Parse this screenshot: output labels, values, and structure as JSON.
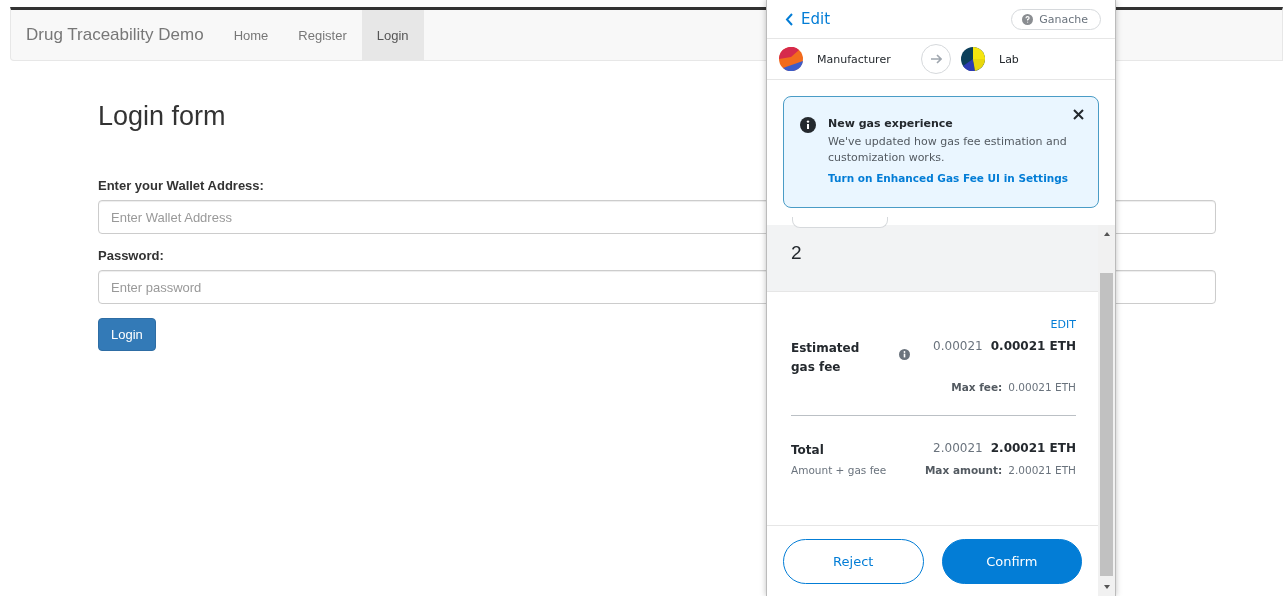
{
  "navbar": {
    "brand": "Drug Traceability Demo",
    "links": [
      {
        "label": "Home",
        "selected": false
      },
      {
        "label": "Register",
        "selected": false
      },
      {
        "label": "Login",
        "selected": true
      }
    ]
  },
  "form": {
    "title": "Login form",
    "fields": [
      {
        "label": "Enter your Wallet Address:",
        "placeholder": "Enter Wallet Address"
      },
      {
        "label": "Password:",
        "placeholder": "Enter password"
      }
    ],
    "submit": "Login"
  },
  "popup": {
    "back_label": "Edit",
    "network": "Ganache",
    "from": "Manufacturer",
    "to": "Lab",
    "notice": {
      "title": "New gas experience",
      "body": "We've updated how gas fee estimation and customization works.",
      "link": "Turn on Enhanced Gas Fee UI in Settings"
    },
    "amount": "2",
    "edit_link": "EDIT",
    "gas": {
      "label": "Estimated gas fee",
      "value": "0.00021",
      "value_bold": "0.00021 ETH",
      "max_label": "Max fee:",
      "max_value": "0.00021 ETH"
    },
    "total": {
      "label": "Total",
      "sublabel": "Amount + gas fee",
      "value": "2.00021",
      "value_bold": "2.00021 ETH",
      "max_label": "Max amount:",
      "max_value": "2.00021 ETH"
    },
    "buttons": {
      "reject": "Reject",
      "confirm": "Confirm"
    }
  }
}
